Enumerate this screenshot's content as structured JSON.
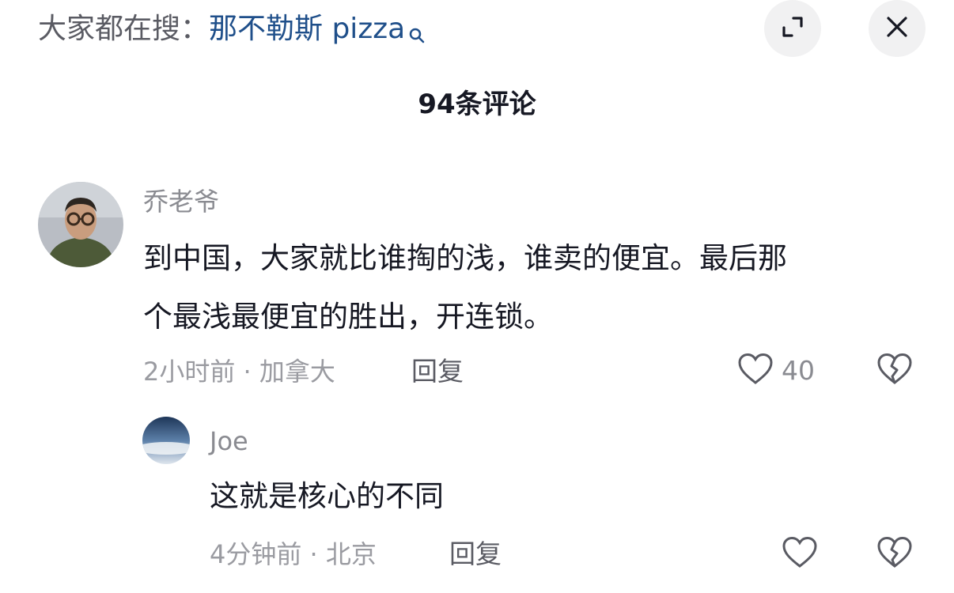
{
  "header": {
    "search_prefix": "大家都在搜：",
    "search_keyword": "那不勒斯 pizza"
  },
  "comments_title": "94条评论",
  "comment": {
    "username": "乔老爷",
    "text_line1": "到中国，大家就比谁掏的浅，谁卖的便宜。最后那",
    "text_line2": "个最浅最便宜的胜出，开连锁。",
    "meta": "2小时前 · 加拿大",
    "reply_label": "回复",
    "like_count": "40"
  },
  "reply": {
    "username": "Joe",
    "text": "这就是核心的不同",
    "meta": "4分钟前 · 北京",
    "reply_label": "回复"
  },
  "icons": {
    "search": "magnifier-icon",
    "expand": "expand-icon",
    "close": "close-icon",
    "like": "heart-outline-icon",
    "dislike": "broken-heart-icon"
  },
  "colors": {
    "keyword_link": "#1f4f8a",
    "secondary_text": "#8a8b91",
    "button_bg": "#f1f1f2"
  }
}
